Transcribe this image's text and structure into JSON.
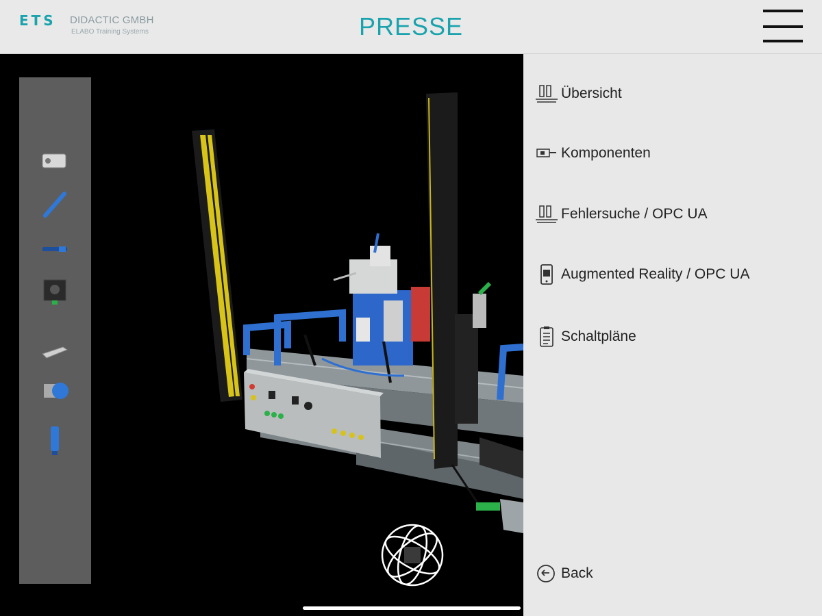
{
  "header": {
    "logo_mark": "ETS",
    "company": "DIDACTIC GMBH",
    "company_sub": "ELABO Training Systems",
    "title": "PRESSE"
  },
  "toolbar": {
    "tools": [
      {
        "name": "cylinder-component-icon"
      },
      {
        "name": "blue-sensor-rod-icon"
      },
      {
        "name": "slim-sensor-icon"
      },
      {
        "name": "module-box-icon"
      },
      {
        "name": "gripper-icon"
      },
      {
        "name": "proximity-sensor-icon"
      },
      {
        "name": "connector-icon"
      }
    ]
  },
  "menu": {
    "items": [
      {
        "label": "Übersicht",
        "icon": "overview-icon"
      },
      {
        "label": "Komponenten",
        "icon": "components-icon"
      },
      {
        "label": "Fehlersuche / OPC UA",
        "icon": "troubleshooting-icon"
      },
      {
        "label": "Augmented Reality / OPC UA",
        "icon": "ar-phone-icon"
      },
      {
        "label": "Schaltpläne",
        "icon": "circuit-diagram-icon"
      }
    ],
    "back_label": "Back"
  }
}
